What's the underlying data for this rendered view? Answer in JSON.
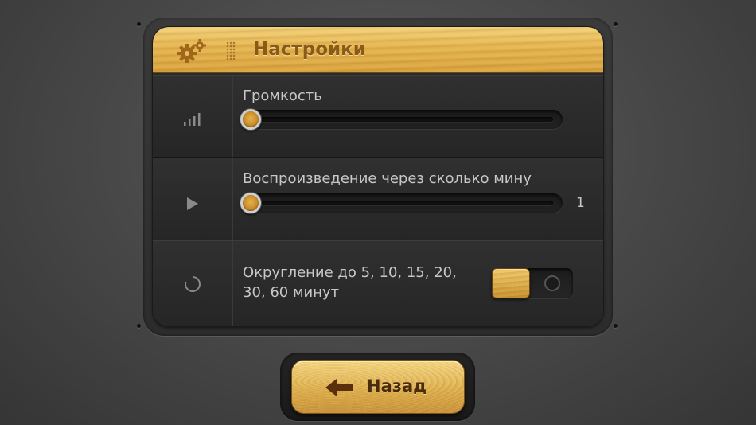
{
  "header": {
    "title": "Настройки",
    "icon": "gears-icon"
  },
  "rows": [
    {
      "icon": "volume-bars-icon",
      "label": "Громкость",
      "slider_value": 0,
      "value_text": ""
    },
    {
      "icon": "play-icon",
      "label": "Воспроизведение через сколько мину",
      "slider_value": 1,
      "value_text": "1"
    },
    {
      "icon": "circle-refresh-icon",
      "label_line1": "Округление до 5, 10, 15, 20,",
      "label_line2": "30, 60 минут",
      "toggle_on": true
    }
  ],
  "footer": {
    "back_label": "Назад",
    "icon": "arrow-left-icon"
  },
  "colors": {
    "accent_wood": "#e6b550",
    "panel": "#2a2a2a",
    "text": "#c8c8c8"
  }
}
